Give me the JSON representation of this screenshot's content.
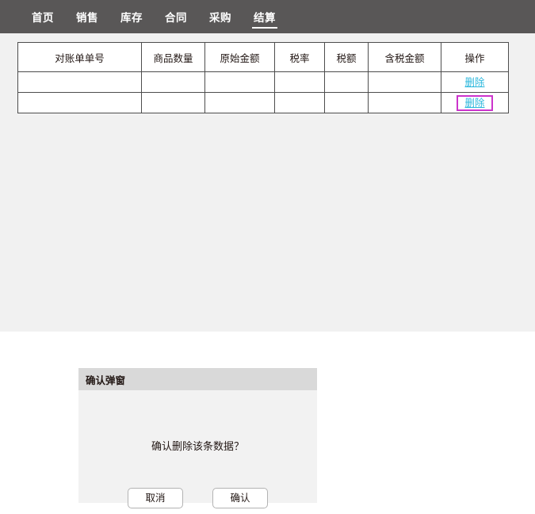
{
  "nav": {
    "items": [
      {
        "label": "首页",
        "active": false
      },
      {
        "label": "销售",
        "active": false
      },
      {
        "label": "库存",
        "active": false
      },
      {
        "label": "合同",
        "active": false
      },
      {
        "label": "采购",
        "active": false
      },
      {
        "label": "结算",
        "active": true
      }
    ]
  },
  "table": {
    "headers": {
      "order_no": "对账单单号",
      "quantity": "商品数量",
      "original_amount": "原始金额",
      "tax_rate": "税率",
      "tax_amount": "税额",
      "taxed_amount": "含税金额",
      "action": "操作"
    },
    "rows": [
      {
        "order_no": "",
        "quantity": "",
        "original_amount": "",
        "tax_rate": "",
        "tax_amount": "",
        "taxed_amount": "",
        "action_label": "删除",
        "highlighted": false
      },
      {
        "order_no": "",
        "quantity": "",
        "original_amount": "",
        "tax_rate": "",
        "tax_amount": "",
        "taxed_amount": "",
        "action_label": "删除",
        "highlighted": true
      }
    ]
  },
  "dialog": {
    "title": "确认弹窗",
    "message": "确认删除该条数据？",
    "cancel_label": "取消",
    "confirm_label": "确认"
  },
  "colors": {
    "nav_background": "#595757",
    "content_background": "#f1f1f1",
    "link": "#2eb8dd",
    "highlight_border": "#cc33cc",
    "dialog_header": "#d9d9d9",
    "dialog_body": "#f2f2f2"
  }
}
